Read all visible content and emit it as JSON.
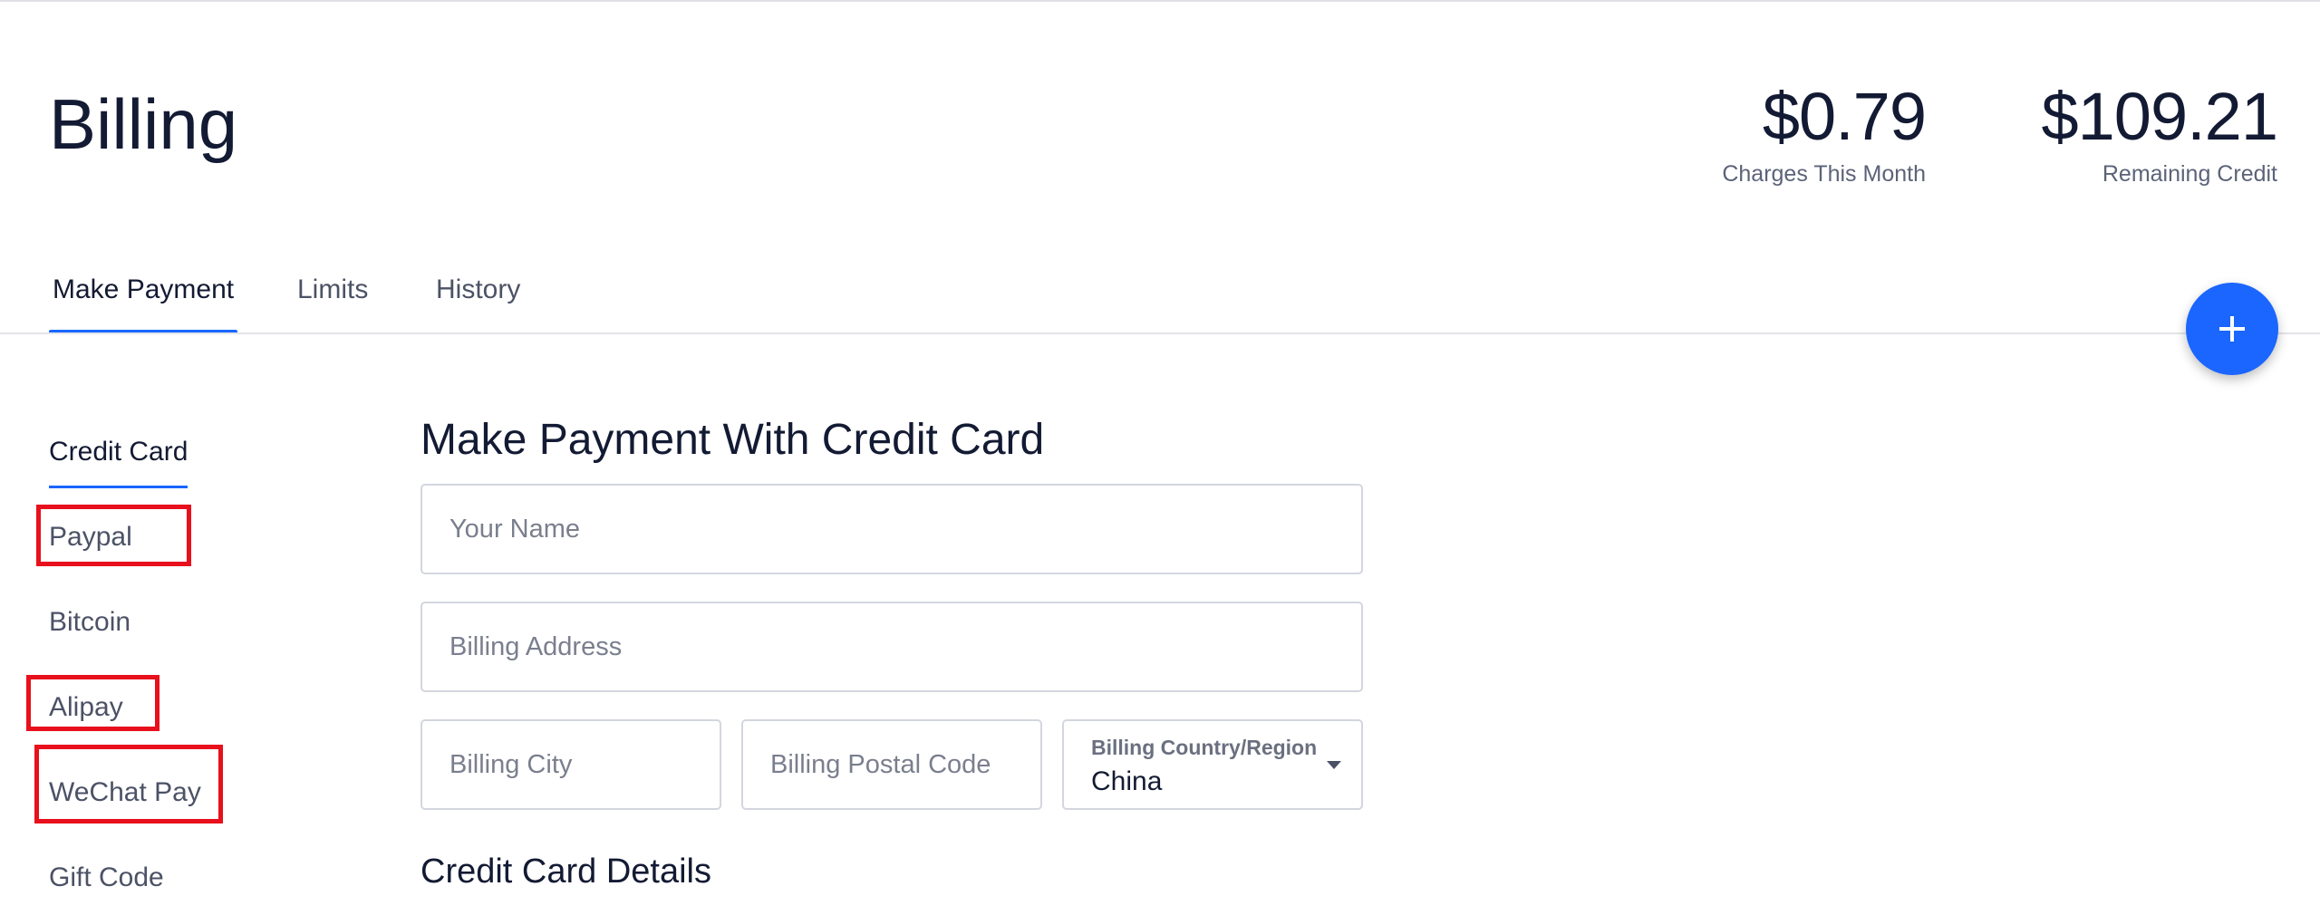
{
  "page": {
    "title": "Billing"
  },
  "stats": [
    {
      "value": "$0.79",
      "label": "Charges This Month"
    },
    {
      "value": "$109.21",
      "label": "Remaining Credit"
    }
  ],
  "tabs": [
    {
      "label": "Make Payment",
      "active": true
    },
    {
      "label": "Limits",
      "active": false
    },
    {
      "label": "History",
      "active": false
    }
  ],
  "fab": {
    "icon": "plus-icon"
  },
  "payment_methods": [
    {
      "label": "Credit Card",
      "active": true
    },
    {
      "label": "Paypal",
      "active": false
    },
    {
      "label": "Bitcoin",
      "active": false
    },
    {
      "label": "Alipay",
      "active": false
    },
    {
      "label": "WeChat Pay",
      "active": false
    },
    {
      "label": "Gift Code",
      "active": false
    }
  ],
  "form": {
    "title": "Make Payment With Credit Card",
    "name_placeholder": "Your Name",
    "address_placeholder": "Billing Address",
    "city_placeholder": "Billing City",
    "postal_placeholder": "Billing Postal Code",
    "country_label": "Billing Country/Region",
    "country_value": "China",
    "card_section_title": "Credit Card Details"
  },
  "colors": {
    "accent": "#1a66ff",
    "highlight_box": "#e8101c",
    "text_primary": "#131a33",
    "text_secondary": "#4c5266"
  }
}
